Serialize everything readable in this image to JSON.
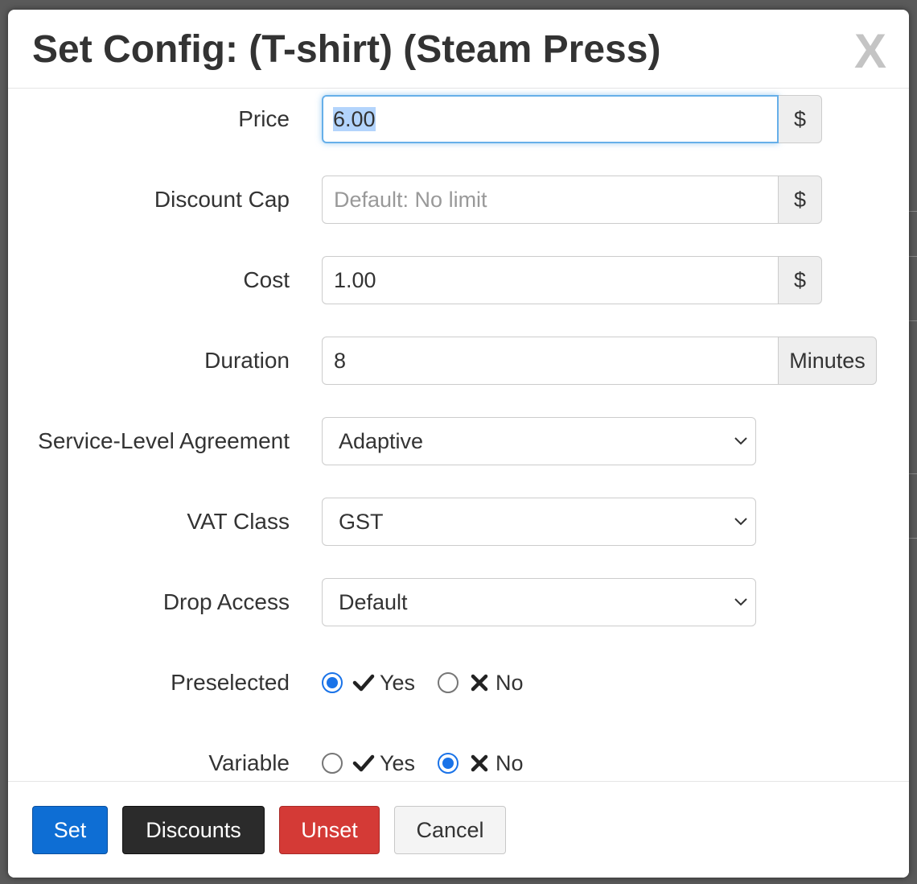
{
  "modal": {
    "title": "Set Config: (T-shirt) (Steam Press)",
    "close_label": "X"
  },
  "form": {
    "price": {
      "label": "Price",
      "value": "6.00",
      "addon": "$"
    },
    "discount_cap": {
      "label": "Discount Cap",
      "value": "",
      "placeholder": "Default: No limit",
      "addon": "$"
    },
    "cost": {
      "label": "Cost",
      "value": "1.00",
      "addon": "$"
    },
    "duration": {
      "label": "Duration",
      "value": "8",
      "addon": "Minutes"
    },
    "sla": {
      "label": "Service-Level Agreement",
      "selected": "Adaptive"
    },
    "vat_class": {
      "label": "VAT Class",
      "selected": "GST"
    },
    "drop_access": {
      "label": "Drop Access",
      "selected": "Default"
    },
    "preselected": {
      "label": "Preselected",
      "yes": "Yes",
      "no": "No",
      "value": "yes"
    },
    "variable": {
      "label": "Variable",
      "yes": "Yes",
      "no": "No",
      "value": "no"
    }
  },
  "footer": {
    "set": "Set",
    "discounts": "Discounts",
    "unset": "Unset",
    "cancel": "Cancel"
  },
  "colors": {
    "primary": "#0e6ed4",
    "dark": "#2b2b2b",
    "danger": "#d43a36",
    "focus": "#66afe9",
    "radio_checked": "#1a73e8"
  }
}
